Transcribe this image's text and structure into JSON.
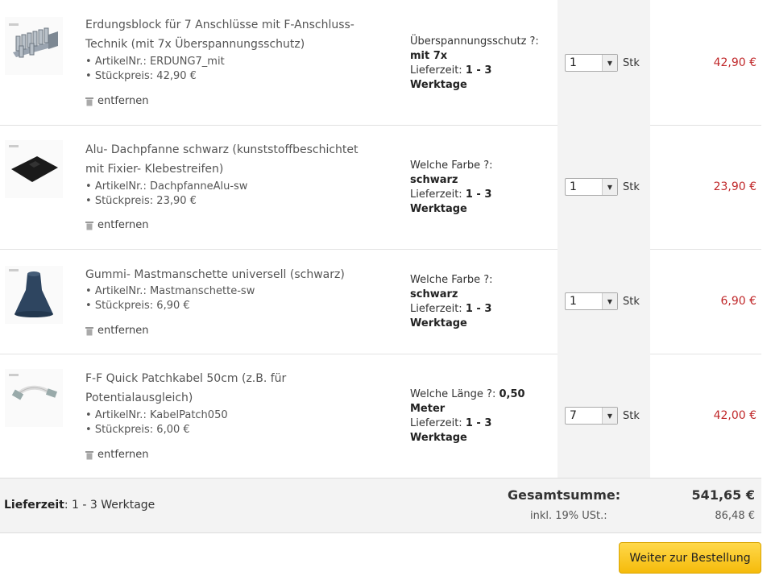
{
  "items": [
    {
      "name": "Erdungsblock für 7 Anschlüsse mit F-Anschluss-Technik (mit 7x Überspannungsschutz)",
      "name_lines": [
        "Erdungsblock für 7 Anschlüsse mit F-Anschluss-",
        "Technik (mit 7x Überspannungsschutz)"
      ],
      "article_label": "ArtikelNr.:",
      "article": "ERDUNG7_mit",
      "unit_price_label": "Stückpreis:",
      "unit_price": "42,90 €",
      "remove_label": "entfernen",
      "option_label": "Überspannungsschutz ?:",
      "option_value": "mit 7x",
      "delivery_label": "Lieferzeit:",
      "delivery_value": "1 - 3",
      "delivery_unit": "Werktage",
      "quantity": "1",
      "unit": "Stk",
      "total": "42,90 €",
      "image_icon": "grounding-block-icon"
    },
    {
      "name": "Alu- Dachpfanne schwarz (kunststoffbeschichtet mit Fixier- Klebestreifen)",
      "name_lines": [
        "Alu- Dachpfanne schwarz (kunststoffbeschichtet",
        "mit Fixier- Klebestreifen)"
      ],
      "article_label": "ArtikelNr.:",
      "article": "DachpfanneAlu-sw",
      "unit_price_label": "Stückpreis:",
      "unit_price": "23,90 €",
      "remove_label": "entfernen",
      "option_label": "Welche Farbe ?:",
      "option_value": "schwarz",
      "delivery_label": "Lieferzeit:",
      "delivery_value": "1 - 3",
      "delivery_unit": "Werktage",
      "quantity": "1",
      "unit": "Stk",
      "total": "23,90 €",
      "image_icon": "roof-tile-icon"
    },
    {
      "name": "Gummi- Mastmanschette universell (schwarz)",
      "name_lines": [
        "Gummi- Mastmanschette universell (schwarz)"
      ],
      "article_label": "ArtikelNr.:",
      "article": "Mastmanschette-sw",
      "unit_price_label": "Stückpreis:",
      "unit_price": "6,90 €",
      "remove_label": "entfernen",
      "option_label": "Welche Farbe ?:",
      "option_value": "schwarz",
      "delivery_label": "Lieferzeit:",
      "delivery_value": "1 - 3",
      "delivery_unit": "Werktage",
      "quantity": "1",
      "unit": "Stk",
      "total": "6,90 €",
      "image_icon": "mast-sleeve-icon"
    },
    {
      "name": "F-F Quick Patchkabel 50cm (z.B. für Potentialausgleich)",
      "name_lines": [
        "F-F Quick Patchkabel 50cm (z.B. für",
        "Potentialausgleich)"
      ],
      "article_label": "ArtikelNr.:",
      "article": "KabelPatch050",
      "unit_price_label": "Stückpreis:",
      "unit_price": "6,00 €",
      "remove_label": "entfernen",
      "option_label": "Welche Länge ?:",
      "option_value": "0,50",
      "option_value_2": "Meter",
      "delivery_label": "Lieferzeit:",
      "delivery_value": "1 - 3",
      "delivery_unit": "Werktage",
      "quantity": "7",
      "unit": "Stk",
      "total": "42,00 €",
      "image_icon": "patch-cable-icon"
    }
  ],
  "summary": {
    "delivery_label": "Lieferzeit",
    "delivery_value": ": 1 - 3 Werktage",
    "total_label": "Gesamtsumme:",
    "total_value": "541,65 €",
    "vat_label": "inkl. 19% USt.:",
    "vat_value": "86,48 €"
  },
  "checkout_button": "Weiter zur Bestellung",
  "colors": {
    "price": "#c0282a",
    "button": "#f5bb0b",
    "qty_column": "#f3f3f3"
  }
}
